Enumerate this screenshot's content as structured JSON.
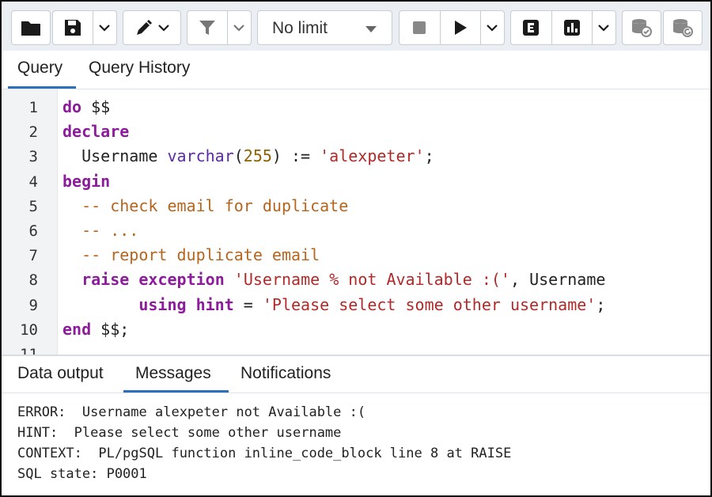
{
  "toolbar": {
    "limit_label": "No limit",
    "icons": [
      "folder-icon",
      "save-icon",
      "chevron-down-icon",
      "pen-icon",
      "filter-icon",
      "stop-icon",
      "play-icon",
      "explain-icon",
      "explain-analyze-icon",
      "commit-icon",
      "rollback-icon"
    ]
  },
  "editor_tabs": [
    {
      "label": "Query",
      "active": true
    },
    {
      "label": "Query History",
      "active": false
    }
  ],
  "code": {
    "line_numbers": [
      "1",
      "2",
      "3",
      "4",
      "5",
      "6",
      "7",
      "8",
      "9",
      "10",
      "11"
    ],
    "lines": [
      [
        {
          "t": "do",
          "c": "kw"
        },
        {
          "t": " $$",
          "c": ""
        }
      ],
      [
        {
          "t": "declare",
          "c": "kw"
        }
      ],
      [
        {
          "t": "  Username ",
          "c": ""
        },
        {
          "t": "varchar",
          "c": "ty"
        },
        {
          "t": "(",
          "c": ""
        },
        {
          "t": "255",
          "c": "num"
        },
        {
          "t": ") := ",
          "c": ""
        },
        {
          "t": "'alexpeter'",
          "c": "str"
        },
        {
          "t": ";",
          "c": ""
        }
      ],
      [
        {
          "t": "begin",
          "c": "kw"
        }
      ],
      [
        {
          "t": "  -- check email for duplicate",
          "c": "cm"
        }
      ],
      [
        {
          "t": "  -- ...",
          "c": "cm"
        }
      ],
      [
        {
          "t": "  -- report duplicate email",
          "c": "cm"
        }
      ],
      [
        {
          "t": "  ",
          "c": ""
        },
        {
          "t": "raise",
          "c": "kw"
        },
        {
          "t": " ",
          "c": ""
        },
        {
          "t": "exception",
          "c": "kw"
        },
        {
          "t": " ",
          "c": ""
        },
        {
          "t": "'Username % not Available :('",
          "c": "str"
        },
        {
          "t": ", Username",
          "c": ""
        }
      ],
      [
        {
          "t": "        ",
          "c": ""
        },
        {
          "t": "using",
          "c": "kw"
        },
        {
          "t": " ",
          "c": ""
        },
        {
          "t": "hint",
          "c": "kw"
        },
        {
          "t": " = ",
          "c": ""
        },
        {
          "t": "'Please select some other username'",
          "c": "str"
        },
        {
          "t": ";",
          "c": ""
        }
      ],
      [
        {
          "t": "end",
          "c": "kw"
        },
        {
          "t": " $$;",
          "c": ""
        }
      ],
      []
    ]
  },
  "result_tabs": [
    {
      "label": "Data output",
      "active": false
    },
    {
      "label": "Messages",
      "active": true
    },
    {
      "label": "Notifications",
      "active": false
    }
  ],
  "messages": {
    "error": "ERROR:  Username alexpeter not Available :(",
    "hint": "HINT:  Please select some other username",
    "context": "CONTEXT:  PL/pgSQL function inline_code_block line 8 at RAISE",
    "sql_state": "SQL state: P0001"
  },
  "colors": {
    "accent": "#2c6fbf",
    "keyword": "#8b1d9b",
    "string": "#b12929",
    "comment": "#b5651d"
  }
}
